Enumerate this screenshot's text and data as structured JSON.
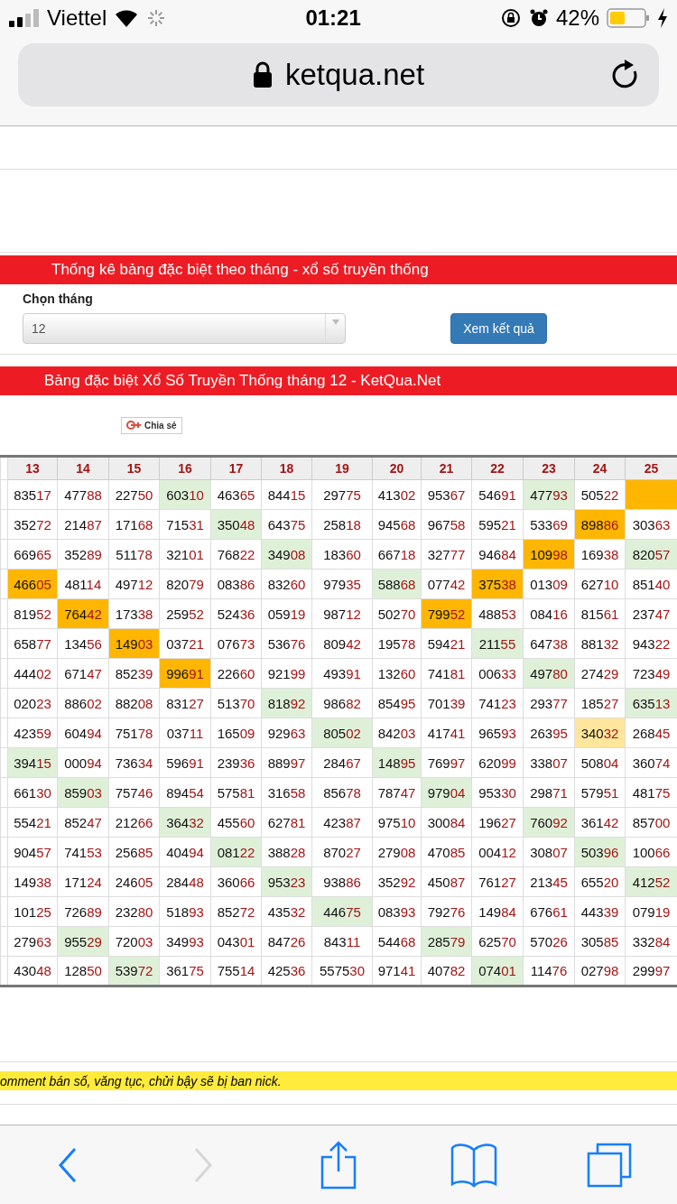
{
  "status_bar": {
    "carrier": "Viettel",
    "time": "01:21",
    "battery": "42%"
  },
  "browser": {
    "address": "ketqua.net"
  },
  "filter_section": {
    "title": "Thống kê bảng đặc biệt theo tháng - xổ số truyền thống",
    "label": "Chọn tháng",
    "month_value": "12",
    "submit": "Xem kết quả"
  },
  "results": {
    "title": "Bảng đặc biệt Xổ Số Truyền Thống tháng 12 - KetQua.Net",
    "share": "Chia sẻ",
    "columns": [
      "13",
      "14",
      "15",
      "16",
      "17",
      "18",
      "19",
      "20",
      "21",
      "22",
      "23",
      "24",
      "25"
    ],
    "rows": [
      [
        {
          "number": "83517"
        },
        {
          "number": "47788"
        },
        {
          "number": "22750"
        },
        {
          "number": "60310",
          "color": "#dff0d8"
        },
        {
          "number": "46365"
        },
        {
          "number": "84415"
        },
        {
          "number": "29775"
        },
        {
          "number": "41302"
        },
        {
          "number": "95367"
        },
        {
          "number": "54691"
        },
        {
          "number": "47793",
          "color": "#dff0d8"
        },
        {
          "number": "50522"
        },
        {
          "color": "#ffb600"
        }
      ],
      [
        {
          "number": "35272"
        },
        {
          "number": "21487"
        },
        {
          "number": "17168"
        },
        {
          "number": "71531"
        },
        {
          "number": "35048",
          "color": "#dff0d8"
        },
        {
          "number": "64375"
        },
        {
          "number": "25818"
        },
        {
          "number": "94568"
        },
        {
          "number": "96758"
        },
        {
          "number": "59521"
        },
        {
          "number": "53369"
        },
        {
          "number": "89886",
          "color": "#ffb600"
        },
        {
          "number": "30363"
        }
      ],
      [
        {
          "number": "66965"
        },
        {
          "number": "35289"
        },
        {
          "number": "51178"
        },
        {
          "number": "32101"
        },
        {
          "number": "76822"
        },
        {
          "number": "34908",
          "color": "#dff0d8"
        },
        {
          "number": "18360"
        },
        {
          "number": "66718"
        },
        {
          "number": "32777"
        },
        {
          "number": "94684"
        },
        {
          "number": "10998",
          "color": "#ffb600"
        },
        {
          "number": "16938"
        },
        {
          "number": "82057",
          "color": "#dff0d8"
        }
      ],
      [
        {
          "number": "46605",
          "color": "#ffb600"
        },
        {
          "number": "48114"
        },
        {
          "number": "49712"
        },
        {
          "number": "82079"
        },
        {
          "number": "08386"
        },
        {
          "number": "83260"
        },
        {
          "number": "97935"
        },
        {
          "number": "58868",
          "color": "#dff0d8"
        },
        {
          "number": "07742"
        },
        {
          "number": "37538",
          "color": "#ffb600"
        },
        {
          "number": "01309"
        },
        {
          "number": "62710"
        },
        {
          "number": "85140"
        }
      ],
      [
        {
          "number": "81952"
        },
        {
          "number": "76442",
          "color": "#ffb600"
        },
        {
          "number": "17338"
        },
        {
          "number": "25952"
        },
        {
          "number": "52436"
        },
        {
          "number": "05919"
        },
        {
          "number": "98712"
        },
        {
          "number": "50270"
        },
        {
          "number": "79952",
          "color": "#ffb600"
        },
        {
          "number": "48853"
        },
        {
          "number": "08416"
        },
        {
          "number": "81561"
        },
        {
          "number": "23747"
        }
      ],
      [
        {
          "number": "65877"
        },
        {
          "number": "13456"
        },
        {
          "number": "14903",
          "color": "#ffb600"
        },
        {
          "number": "03721"
        },
        {
          "number": "07673"
        },
        {
          "number": "53676"
        },
        {
          "number": "80942"
        },
        {
          "number": "19578"
        },
        {
          "number": "59421"
        },
        {
          "number": "21155",
          "color": "#dff0d8"
        },
        {
          "number": "64738"
        },
        {
          "number": "88132"
        },
        {
          "number": "94322"
        }
      ],
      [
        {
          "number": "44402"
        },
        {
          "number": "67147"
        },
        {
          "number": "85239"
        },
        {
          "number": "99691",
          "color": "#ffb600"
        },
        {
          "number": "22660"
        },
        {
          "number": "92199"
        },
        {
          "number": "49391"
        },
        {
          "number": "13260"
        },
        {
          "number": "74181"
        },
        {
          "number": "00633"
        },
        {
          "number": "49780",
          "color": "#dff0d8"
        },
        {
          "number": "27429"
        },
        {
          "number": "72349"
        }
      ],
      [
        {
          "number": "02023"
        },
        {
          "number": "88602"
        },
        {
          "number": "88208"
        },
        {
          "number": "83127"
        },
        {
          "number": "51370"
        },
        {
          "number": "81892",
          "color": "#dff0d8"
        },
        {
          "number": "98682"
        },
        {
          "number": "85495"
        },
        {
          "number": "70139"
        },
        {
          "number": "74123"
        },
        {
          "number": "29377"
        },
        {
          "number": "18527"
        },
        {
          "number": "63513",
          "color": "#dff0d8"
        }
      ],
      [
        {
          "number": "42359"
        },
        {
          "number": "60494"
        },
        {
          "number": "75178"
        },
        {
          "number": "03711"
        },
        {
          "number": "16509"
        },
        {
          "number": "92963"
        },
        {
          "number": "80502",
          "color": "#dff0d8"
        },
        {
          "number": "84203"
        },
        {
          "number": "41741"
        },
        {
          "number": "96593"
        },
        {
          "number": "26395"
        },
        {
          "number": "34032",
          "color": "#ffe69c"
        },
        {
          "number": "26845"
        }
      ],
      [
        {
          "number": "39415",
          "color": "#dff0d8"
        },
        {
          "number": "00094"
        },
        {
          "number": "73634"
        },
        {
          "number": "59691"
        },
        {
          "number": "23936"
        },
        {
          "number": "88997"
        },
        {
          "number": "28467"
        },
        {
          "number": "14895",
          "color": "#dff0d8"
        },
        {
          "number": "76997"
        },
        {
          "number": "62099"
        },
        {
          "number": "33807"
        },
        {
          "number": "50804"
        },
        {
          "number": "36074"
        }
      ],
      [
        {
          "number": "66130"
        },
        {
          "number": "85903",
          "color": "#dff0d8"
        },
        {
          "number": "75746"
        },
        {
          "number": "89454"
        },
        {
          "number": "57581"
        },
        {
          "number": "31658"
        },
        {
          "number": "85678"
        },
        {
          "number": "78747"
        },
        {
          "number": "97904",
          "color": "#dff0d8"
        },
        {
          "number": "95330"
        },
        {
          "number": "29871"
        },
        {
          "number": "57951"
        },
        {
          "number": "48175"
        }
      ],
      [
        {
          "number": "55421"
        },
        {
          "number": "85247"
        },
        {
          "number": "21266"
        },
        {
          "number": "36432",
          "color": "#dff0d8"
        },
        {
          "number": "45560"
        },
        {
          "number": "62781"
        },
        {
          "number": "42387"
        },
        {
          "number": "97510"
        },
        {
          "number": "30084"
        },
        {
          "number": "19627"
        },
        {
          "number": "76092",
          "color": "#dff0d8"
        },
        {
          "number": "36142"
        },
        {
          "number": "85700"
        }
      ],
      [
        {
          "number": "90457"
        },
        {
          "number": "74153"
        },
        {
          "number": "25685"
        },
        {
          "number": "40494"
        },
        {
          "number": "08122",
          "color": "#dff0d8"
        },
        {
          "number": "38828"
        },
        {
          "number": "87027"
        },
        {
          "number": "27908"
        },
        {
          "number": "47085"
        },
        {
          "number": "00412"
        },
        {
          "number": "30807"
        },
        {
          "number": "50396",
          "color": "#dff0d8"
        },
        {
          "number": "10066"
        }
      ],
      [
        {
          "number": "14938"
        },
        {
          "number": "17124"
        },
        {
          "number": "24605"
        },
        {
          "number": "28448"
        },
        {
          "number": "36066"
        },
        {
          "number": "95323",
          "color": "#dff0d8"
        },
        {
          "number": "93886"
        },
        {
          "number": "35292"
        },
        {
          "number": "45087"
        },
        {
          "number": "76127"
        },
        {
          "number": "21345"
        },
        {
          "number": "65520"
        },
        {
          "number": "41252",
          "color": "#dff0d8"
        }
      ],
      [
        {
          "number": "10125"
        },
        {
          "number": "72689"
        },
        {
          "number": "23280"
        },
        {
          "number": "51893"
        },
        {
          "number": "85272"
        },
        {
          "number": "43532"
        },
        {
          "number": "44675",
          "color": "#dff0d8"
        },
        {
          "number": "08393"
        },
        {
          "number": "79276"
        },
        {
          "number": "14984"
        },
        {
          "number": "67661"
        },
        {
          "number": "44339"
        },
        {
          "number": "07919"
        }
      ],
      [
        {
          "number": "27963"
        },
        {
          "number": "95529",
          "color": "#dff0d8"
        },
        {
          "number": "72003"
        },
        {
          "number": "34993"
        },
        {
          "number": "04301"
        },
        {
          "number": "84726"
        },
        {
          "number": "84311"
        },
        {
          "number": "54468"
        },
        {
          "number": "28579",
          "color": "#dff0d8"
        },
        {
          "number": "62570"
        },
        {
          "number": "57026"
        },
        {
          "number": "30585"
        },
        {
          "number": "33284"
        }
      ],
      [
        {
          "number": "43048"
        },
        {
          "number": "12850"
        },
        {
          "number": "53972",
          "color": "#dff0d8"
        },
        {
          "number": "36175"
        },
        {
          "number": "75514"
        },
        {
          "number": "42536"
        },
        {
          "number": "557530"
        },
        {
          "number": "97141"
        },
        {
          "number": "40782"
        },
        {
          "number": "07401",
          "color": "#dff0d8"
        },
        {
          "number": "11476"
        },
        {
          "number": "02798"
        },
        {
          "number": "29997"
        }
      ]
    ]
  },
  "notice": "omment bán số, văng tục, chửi bậy sẽ bị ban nick.",
  "toolbar": {
    "forward_disabled": true
  }
}
